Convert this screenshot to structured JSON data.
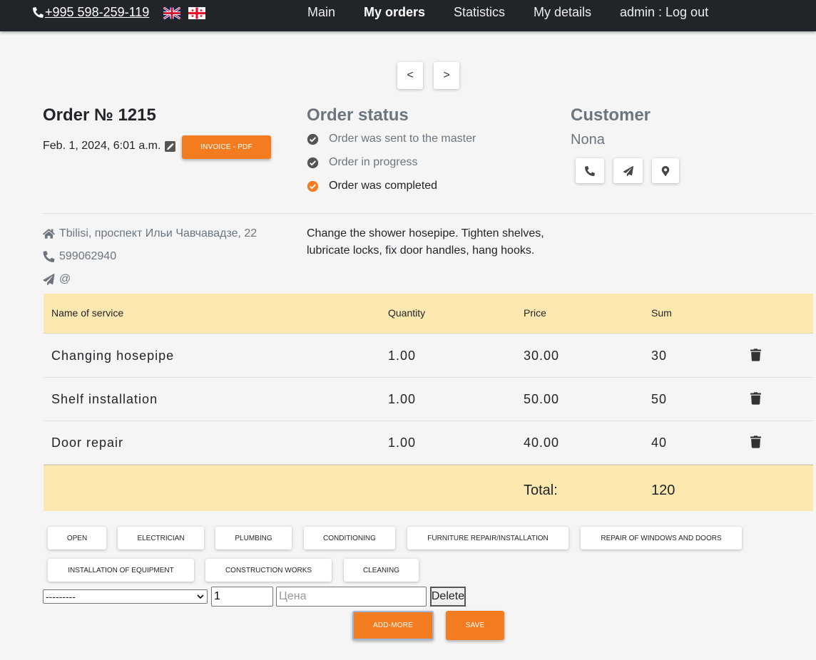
{
  "navbar": {
    "phone": "+995 598-259-119",
    "links": [
      "Main",
      "My orders",
      "Statistics",
      "My details",
      "admin : Log out"
    ]
  },
  "pager": {
    "prev": "<",
    "next": ">"
  },
  "order": {
    "title": "Order № 1215",
    "date": "Feb. 1, 2024, 6:01 a.m.",
    "invoice_button": "INVOICE - PDF",
    "address": "Tbilisi, проспект Ильи Чавчавадзе, 22",
    "phone": "599062940",
    "email": "@",
    "note": "Change the shower hosepipe. Tighten shelves, lubricate locks, fix door handles, hang hooks."
  },
  "status": {
    "title": "Order status",
    "steps": [
      "Order was sent to the master",
      "Order in progress",
      "Order was completed"
    ]
  },
  "customer": {
    "title": "Customer",
    "name": "Nona"
  },
  "table": {
    "headers": [
      "Name of service",
      "Quantity",
      "Price",
      "Sum"
    ],
    "rows": [
      {
        "name": "Changing hosepipe",
        "quantity": "1.00",
        "price": "30.00",
        "sum": "30"
      },
      {
        "name": "Shelf installation",
        "quantity": "1.00",
        "price": "50.00",
        "sum": "50"
      },
      {
        "name": "Door repair",
        "quantity": "1.00",
        "price": "40.00",
        "sum": "40"
      }
    ],
    "total_label": "Total:",
    "total_value": "120"
  },
  "categories": [
    "OPEN",
    "ELECTRICIAN",
    "PLUMBING",
    "CONDITIONING",
    "FURNITURE REPAIR/INSTALLATION",
    "REPAIR OF WINDOWS AND DOORS",
    "INSTALLATION OF EQUIPMENT",
    "CONSTRUCTION WORKS",
    "CLEANING"
  ],
  "form": {
    "service_select": "---------",
    "quantity_value": "1",
    "price_placeholder": "Цена",
    "delete_label": "Delete",
    "add_more_label": "ADD-MORE",
    "save_label": "SAVE"
  },
  "colors": {
    "navbar": "#212529",
    "accent": "#f47c20",
    "table_highlight": "#fde8b0"
  }
}
